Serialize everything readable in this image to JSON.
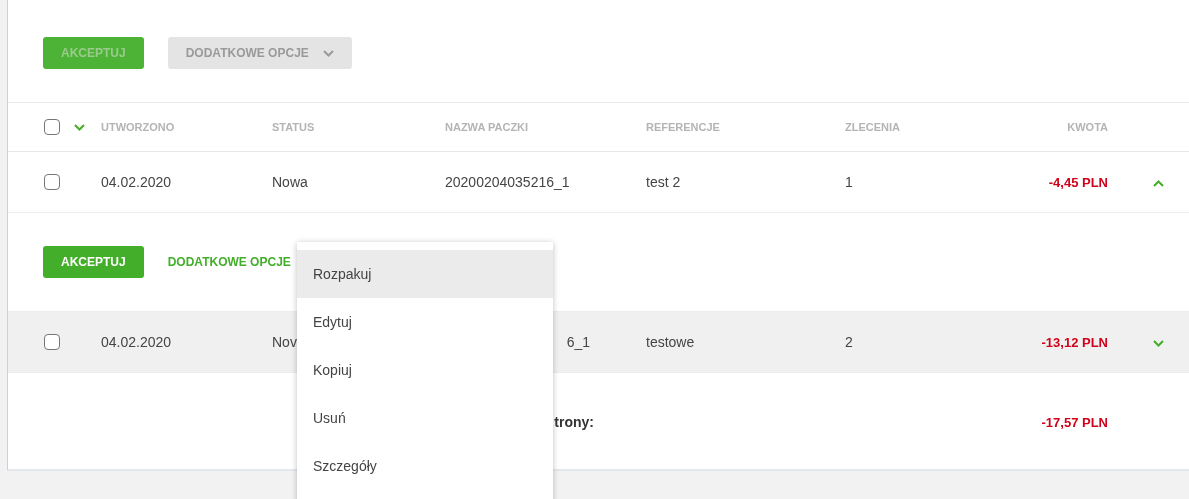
{
  "toolbar": {
    "buttons": [
      {
        "label": "AKCEPTUJ",
        "kind": "primary",
        "disabled": true
      },
      {
        "label": "DODATKOWE OPCJE",
        "kind": "dropdown",
        "disabled": true
      }
    ]
  },
  "table": {
    "select_all": {
      "checked": false
    },
    "columns": [
      "UTWORZONO",
      "STATUS",
      "NAZWA PACZKI",
      "REFERENCJE",
      "ZLECENIA",
      "KWOTA"
    ],
    "rows": [
      {
        "checked": false,
        "hovered": false,
        "expanded": true,
        "cells": [
          {
            "text": "04.02.2020"
          },
          {
            "text": "Nowa"
          },
          {
            "text": "20200204035216_1"
          },
          {
            "text": "test 2"
          },
          {
            "text": "1"
          }
        ],
        "amount": "-4,45 PLN",
        "actions": [
          {
            "label": "AKCEPTUJ",
            "kind": "primary",
            "disabled": false
          },
          {
            "label": "DODATKOWE OPCJE",
            "kind": "link",
            "disabled": false
          }
        ]
      },
      {
        "checked": false,
        "hovered": true,
        "expanded": false,
        "cells": [
          {
            "text": "04.02.2020"
          },
          {
            "text": "Nov"
          },
          {
            "text": "6_1",
            "cut_left": true
          },
          {
            "text": "testowe"
          },
          {
            "text": "2"
          }
        ],
        "amount": "-13,12 PLN"
      }
    ],
    "footer": {
      "label": "trony:",
      "total": "-17,57 PLN"
    }
  },
  "dropdown_menu": {
    "items": [
      {
        "label": "Rozpakuj",
        "hovered": true
      },
      {
        "label": "Edytuj",
        "hovered": false
      },
      {
        "label": "Kopiuj",
        "hovered": false
      },
      {
        "label": "Usuń",
        "hovered": false
      },
      {
        "label": "Szczegóły",
        "hovered": false
      }
    ]
  }
}
